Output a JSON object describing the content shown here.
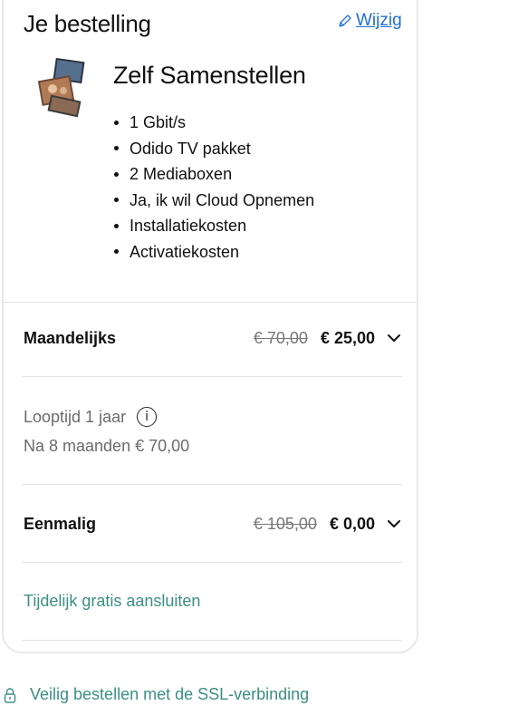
{
  "order": {
    "title": "Je bestelling",
    "edit_label": "Wijzig",
    "product_name": "Zelf Samenstellen",
    "features": [
      "1 Gbit/s",
      "Odido TV pakket",
      "2 Mediaboxen",
      "Ja, ik wil Cloud Opnemen",
      "Installatiekosten",
      "Activatiekosten"
    ]
  },
  "monthly": {
    "label": "Maandelijks",
    "old_price": "€ 70,00",
    "new_price": "€ 25,00",
    "term": "Looptijd 1 jaar",
    "after": "Na 8 maanden € 70,00"
  },
  "once": {
    "label": "Eenmalig",
    "old_price": "€ 105,00",
    "new_price": "€ 0,00"
  },
  "promo": "Tijdelijk gratis aansluiten",
  "ssl": "Veilig bestellen met de SSL-verbinding",
  "colors": {
    "accent": "#3b8f80",
    "link": "#1f6fd6"
  },
  "icons": {
    "edit": "pencil-icon",
    "info": "info-icon",
    "chevron": "chevron-down-icon",
    "lock": "lock-icon"
  }
}
